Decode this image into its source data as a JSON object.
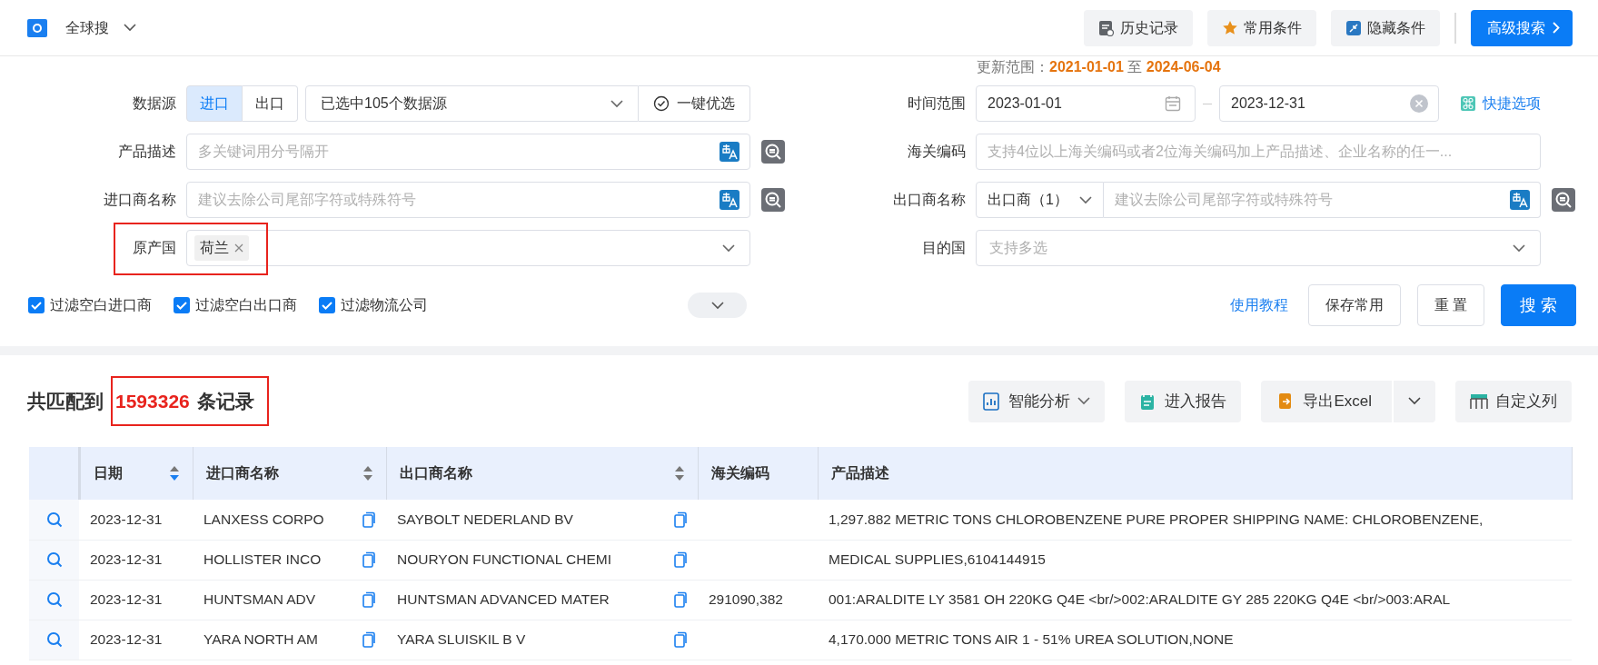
{
  "header": {
    "scope": "全球搜",
    "buttons": [
      {
        "label": "历史记录",
        "kind": "history"
      },
      {
        "label": "常用条件",
        "kind": "star"
      },
      {
        "label": "隐藏条件",
        "kind": "collapse"
      }
    ],
    "advanced": "高级搜索"
  },
  "update_range": {
    "label": "更新范围：",
    "from": "2021-01-01",
    "to_word": "至",
    "to": "2024-06-04"
  },
  "left_fields": [
    {
      "kind": "source",
      "label": "数据源",
      "directions": [
        {
          "label": "进口",
          "selected": true
        },
        {
          "label": "出口",
          "selected": false
        }
      ],
      "value": "已选中105个数据源",
      "action": "一键优选"
    },
    {
      "kind": "text",
      "label": "产品描述",
      "placeholder": "多关键词用分号隔开"
    },
    {
      "kind": "text",
      "label": "进口商名称",
      "placeholder": "建议去除公司尾部字符或特殊符号"
    },
    {
      "kind": "tags",
      "label": "原产国",
      "tags": [
        "荷兰"
      ],
      "highlighted": true
    }
  ],
  "right_fields": [
    {
      "kind": "daterange",
      "label": "时间范围",
      "from": "2023-01-01",
      "to": "2023-12-31",
      "link": "快捷选项"
    },
    {
      "kind": "wide",
      "label": "海关编码",
      "placeholder": "支持4位以上海关编码或者2位海关编码加上产品描述、企业名称的任一..."
    },
    {
      "kind": "company",
      "label": "出口商名称",
      "type": "出口商（1）",
      "placeholder": "建议去除公司尾部字符或特殊符号"
    },
    {
      "kind": "select",
      "label": "目的国",
      "placeholder": "支持多选"
    }
  ],
  "filters": [
    {
      "label": "过滤空白进口商",
      "checked": true
    },
    {
      "label": "过滤空白出口商",
      "checked": true
    },
    {
      "label": "过滤物流公司",
      "checked": true
    }
  ],
  "actions": {
    "tutorial": "使用教程",
    "save": "保存常用",
    "reset": "重 置",
    "search": "搜 索"
  },
  "results": {
    "prefix": "共匹配到",
    "count": "1593326",
    "suffix": "条记录",
    "highlighted": true
  },
  "toolbar": [
    {
      "label": "智能分析",
      "kind": "analysis"
    },
    {
      "label": "进入报告",
      "kind": "report"
    },
    {
      "label": "导出Excel",
      "kind": "export"
    },
    {
      "label": "自定义列",
      "kind": "columns"
    }
  ],
  "table": {
    "columns": [
      {
        "label": "日期",
        "sortable": true,
        "sorted": true
      },
      {
        "label": "进口商名称",
        "sortable": true,
        "sorted": false
      },
      {
        "label": "出口商名称",
        "sortable": true,
        "sorted": false
      },
      {
        "label": "海关编码"
      },
      {
        "label": "产品描述"
      }
    ],
    "rows": [
      {
        "date": "2023-12-31",
        "importer": "LANXESS CORPO",
        "exporter": "SAYBOLT NEDERLAND BV",
        "hs_code": "",
        "description": "1,297.882 METRIC TONS CHLOROBENZENE PURE PROPER SHIPPING NAME: CHLOROBENZENE,"
      },
      {
        "date": "2023-12-31",
        "importer": "HOLLISTER INCO",
        "exporter": "NOURYON FUNCTIONAL CHEMI",
        "hs_code": "",
        "description": "MEDICAL SUPPLIES,6104144915"
      },
      {
        "date": "2023-12-31",
        "importer": "HUNTSMAN ADV",
        "exporter": "HUNTSMAN ADVANCED MATER",
        "hs_code": "291090,382",
        "description": "001:ARALDITE LY 3581 OH 220KG Q4E <br/>002:ARALDITE GY 285 220KG Q4E <br/>003:ARAL"
      },
      {
        "date": "2023-12-31",
        "importer": "YARA NORTH AM",
        "exporter": "YARA SLUISKIL B V",
        "hs_code": "",
        "description": "4,170.000 METRIC TONS AIR 1 - 51% UREA SOLUTION,NONE"
      }
    ]
  }
}
